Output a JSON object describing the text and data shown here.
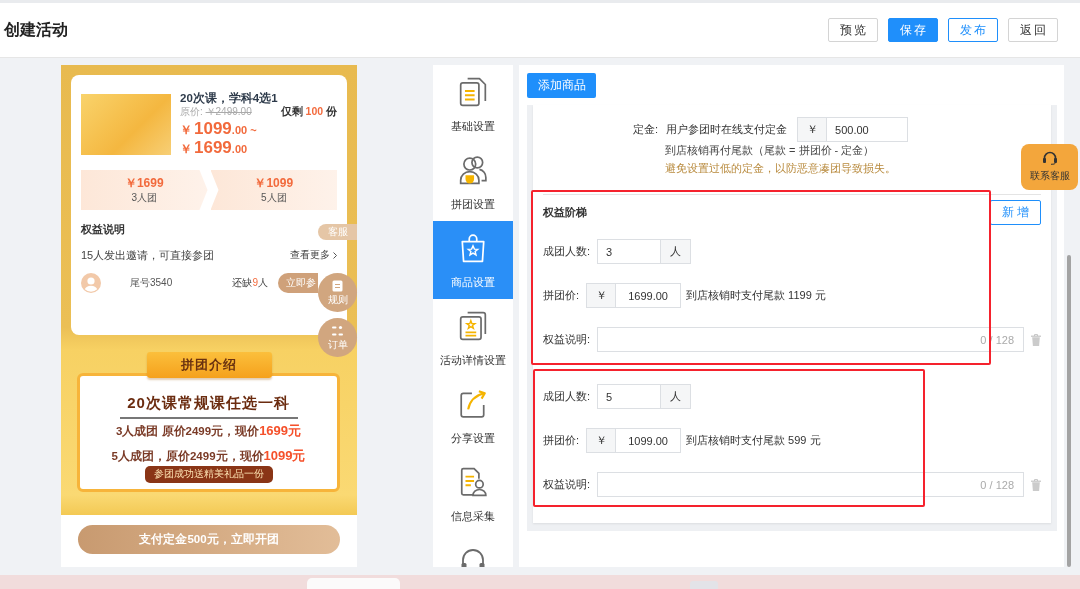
{
  "header": {
    "title": "创建活动",
    "buttons": [
      {
        "label": "预览",
        "kind": "default"
      },
      {
        "label": "保存",
        "kind": "primary"
      },
      {
        "label": "发布",
        "kind": "outline"
      },
      {
        "label": "返回",
        "kind": "default"
      }
    ]
  },
  "preview": {
    "product": {
      "title": "20次课，学科4选1",
      "original_label": "原价:",
      "original_price": "￥2499.00",
      "stock": {
        "prefix": "仅剩",
        "count": "100",
        "unit": "份"
      },
      "prices": [
        {
          "symbol": "￥",
          "amount": "1099",
          "cents": ".00",
          "range_mark": "~"
        },
        {
          "symbol": "￥",
          "amount": "1699",
          "cents": ".00"
        }
      ]
    },
    "group_tiers": [
      {
        "price": "￥1699",
        "label": "3人团"
      },
      {
        "price": "￥1099",
        "label": "5人团"
      }
    ],
    "benefits_title": "权益说明",
    "invite": {
      "text": "15人发出邀请，可直接参团",
      "more": "查看更多"
    },
    "member": {
      "name": "尾号3540",
      "missing_prefix": "还缺",
      "missing_count": "9",
      "missing_unit": "人",
      "join_button": "立即参"
    },
    "side_buttons": [
      {
        "label": "客服",
        "kind": "tag"
      },
      {
        "label": "规则",
        "kind": "circle"
      },
      {
        "label": "订单",
        "kind": "circle"
      }
    ],
    "intro": {
      "banner": "拼团介绍",
      "headline": "20次课常规课任选一科",
      "lines": [
        {
          "text": "3人成团 原价2499元，现价",
          "price": "1699元"
        },
        {
          "text": "5人成团，原价2499元，现价",
          "price": "1099元"
        }
      ],
      "gift": "参团成功送精美礼品一份"
    },
    "pay_button": "支付定金500元，立即开团"
  },
  "nav": {
    "items": [
      {
        "label": "基础设置",
        "selected": false
      },
      {
        "label": "拼团设置",
        "selected": false
      },
      {
        "label": "商品设置",
        "selected": true
      },
      {
        "label": "活动详情设置",
        "selected": false
      },
      {
        "label": "分享设置",
        "selected": false
      },
      {
        "label": "信息采集",
        "selected": false
      },
      {
        "selected": false
      }
    ]
  },
  "form": {
    "add_button": "添加商品",
    "deposit": {
      "label": "定金:",
      "description": "用户参团时在线支付定金",
      "prefix": "￥",
      "value": "500.00",
      "note": "到店核销再付尾款（尾款 = 拼团价 - 定金）",
      "warning": "避免设置过低的定金，以防恶意凑团导致损失。"
    },
    "tier_title": "权益阶梯",
    "add_tier_button": "新 增",
    "tiers": [
      {
        "highlighted": true,
        "size_label": "成团人数:",
        "size_value": "3",
        "size_unit": "人",
        "price_label": "拼团价:",
        "price_prefix": "￥",
        "price_value": "1699.00",
        "balance_note": "到店核销时支付尾款 1199 元",
        "benefit_label": "权益说明:",
        "benefit_counter": "0 / 128"
      },
      {
        "highlighted": true,
        "size_label": "成团人数:",
        "size_value": "5",
        "size_unit": "人",
        "price_label": "拼团价:",
        "price_prefix": "￥",
        "price_value": "1099.00",
        "balance_note": "到店核销时支付尾款 599 元",
        "benefit_label": "权益说明:",
        "benefit_counter": "0 / 128"
      }
    ]
  },
  "support_button": "联系客服"
}
